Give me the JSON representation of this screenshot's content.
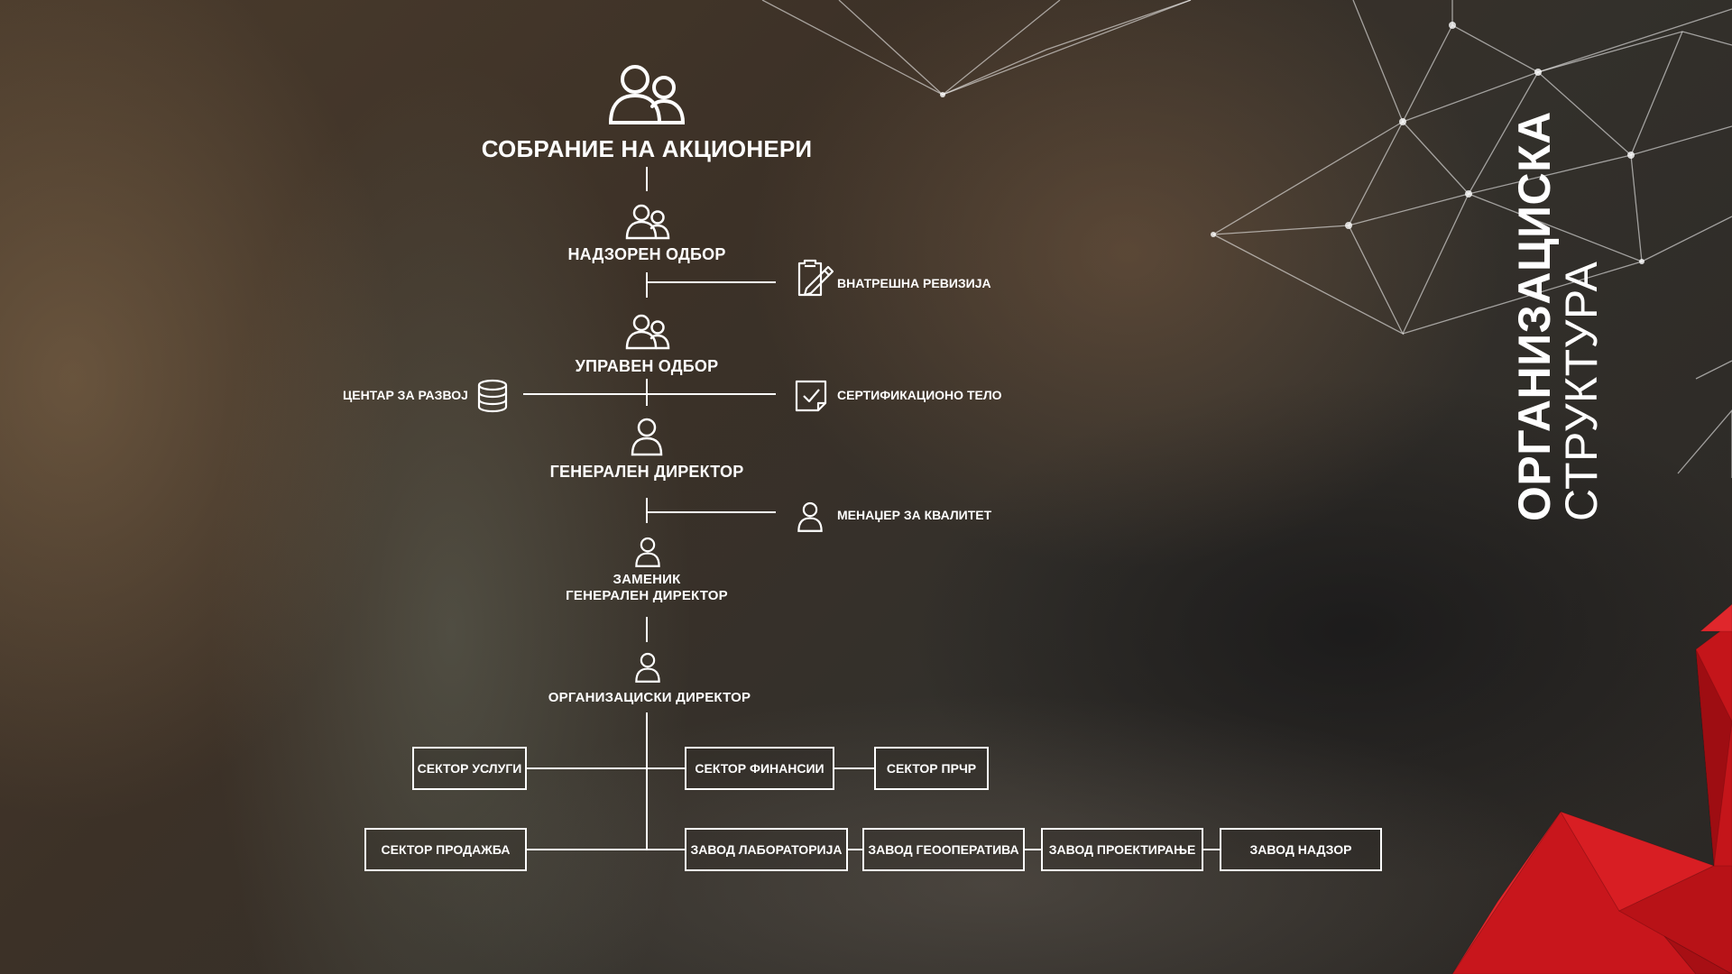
{
  "colors": {
    "text": "#ffffff",
    "line": "#ffffff",
    "accent": "#d81e23"
  },
  "title": {
    "line1": "ОРГАНИЗАЦИСКА",
    "line2": "СТРУКТУРА"
  },
  "nodes": {
    "shareholders": {
      "label": "СОБРАНИЕ НА АКЦИОНЕРИ",
      "icon": "users-group-icon"
    },
    "supervisory_board": {
      "label": "НАДЗОРЕН ОДБОР",
      "icon": "users-group-icon"
    },
    "internal_audit": {
      "label": "ВНАТРЕШНА РЕВИЗИЈА",
      "icon": "clipboard-pen-icon"
    },
    "management_board": {
      "label": "УПРАВЕН ОДБОР",
      "icon": "users-group-icon"
    },
    "development_center": {
      "label": "ЦЕНТАР ЗА РАЗВОЈ",
      "icon": "database-icon"
    },
    "certification_body": {
      "label": "СЕРТИФИКАЦИОНО ТЕЛО",
      "icon": "checkbox-document-icon"
    },
    "general_director": {
      "label": "ГЕНЕРАЛЕН ДИРЕКТОР",
      "icon": "user-icon"
    },
    "quality_manager": {
      "label": "МЕНАЏЕР ЗА КВАЛИТЕТ",
      "icon": "user-icon"
    },
    "deputy_director": {
      "line1": "ЗАМЕНИК",
      "line2": "ГЕНЕРАЛЕН ДИРЕКТОР",
      "icon": "user-icon"
    },
    "organizational_director": {
      "label": "ОРГАНИЗАЦИСКИ ДИРЕКТОР",
      "icon": "user-icon"
    }
  },
  "sectors": {
    "services": "СЕКТОР УСЛУГИ",
    "finance": "СЕКТОР ФИНАНСИИ",
    "hr": "СЕКТОР ПРЧР",
    "sales": "СЕКТОР ПРОДАЖБА",
    "laboratory": "ЗАВОД ЛАБОРАТОРИЈА",
    "geooperations": "ЗАВОД ГЕООПЕРАТИВА",
    "design": "ЗАВОД ПРОЕКТИРАЊЕ",
    "supervision": "ЗАВОД НАДЗОР"
  }
}
